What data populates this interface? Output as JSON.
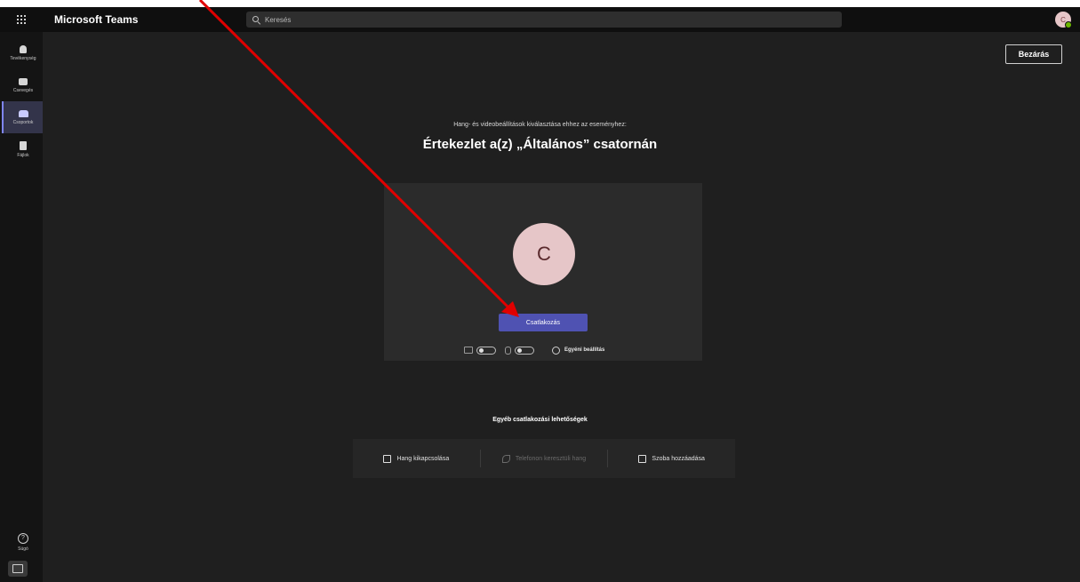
{
  "app": {
    "title": "Microsoft Teams"
  },
  "search": {
    "placeholder": "Keresés"
  },
  "user": {
    "avatar_initial": "C"
  },
  "rail": {
    "items": [
      {
        "label": "Tevékenység",
        "icon": "bell-icon"
      },
      {
        "label": "Csevegés",
        "icon": "chat-icon"
      },
      {
        "label": "Csoportok",
        "icon": "teams-icon",
        "active": true
      },
      {
        "label": "Fájlok",
        "icon": "files-icon"
      }
    ],
    "help_label": "Súgó",
    "download_icon": "download-icon"
  },
  "header": {
    "close_label": "Bezárás"
  },
  "prejoin": {
    "subtitle": "Hang- és videobeállítások kiválasztása ehhez az eseményhez:",
    "title": "Értekezlet a(z) „Általános” csatornán",
    "avatar_initial": "C",
    "join_label": "Csatlakozás",
    "camera_on": false,
    "mic_on": false,
    "settings_label": "Egyéni beállítás"
  },
  "other_options": {
    "heading": "Egyéb csatlakozási lehetőségek",
    "items": [
      {
        "label": "Hang kikapcsolása",
        "icon": "speaker-off-icon",
        "enabled": true
      },
      {
        "label": "Telefonon keresztüli hang",
        "icon": "phone-icon",
        "enabled": false
      },
      {
        "label": "Szoba hozzáadása",
        "icon": "room-icon",
        "enabled": true
      }
    ]
  },
  "colors": {
    "accent": "#4f52b2",
    "annotation_arrow": "#e00000",
    "background": "#1f1f1f"
  }
}
